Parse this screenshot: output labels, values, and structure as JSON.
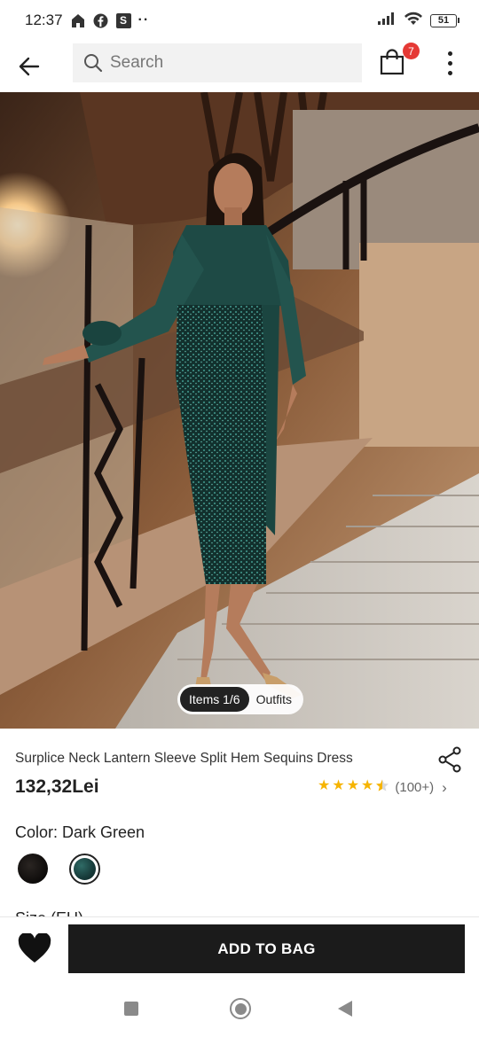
{
  "status_bar": {
    "time": "12:37",
    "app_badge": "S",
    "more_dots": "··",
    "battery": "51"
  },
  "header": {
    "search_placeholder": "Search",
    "cart_count": "7"
  },
  "gallery": {
    "items_tab": "Items 1/6",
    "outfits_tab": "Outfits",
    "dress_color": "#1e4a45"
  },
  "product": {
    "title": "Surplice Neck Lantern Sleeve Split Hem Sequins Dress",
    "price": "132,32Lei",
    "rating": 4.5,
    "review_count": "(100+)",
    "color_label": "Color: Dark Green",
    "size_label": "Size (EU)",
    "colors": [
      {
        "name": "Black",
        "hex": "#151210"
      },
      {
        "name": "Dark Green",
        "hex": "#1f4d49",
        "selected": true
      }
    ]
  },
  "actions": {
    "add_to_bag": "ADD TO BAG"
  },
  "theme": {
    "badge_color": "#e53935",
    "star_color": "#f6b400",
    "primary_button": "#1b1b1b"
  }
}
